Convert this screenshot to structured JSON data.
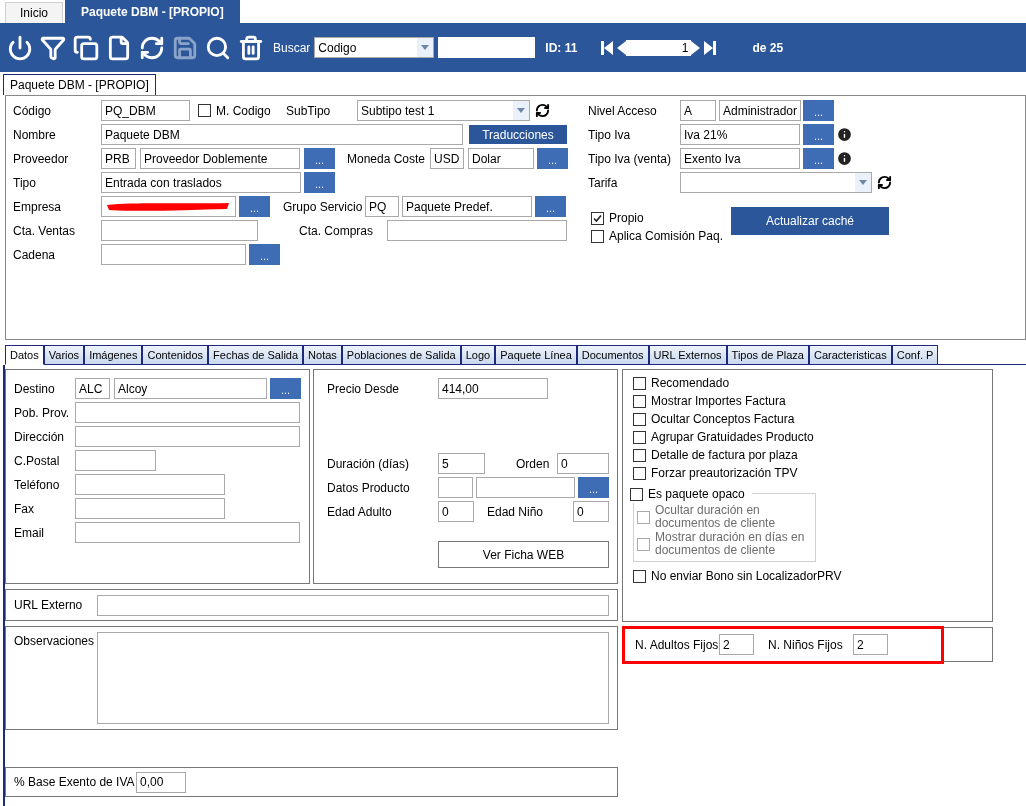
{
  "app_tabs": [
    {
      "label": "Inicio",
      "selected": false
    },
    {
      "label": "Paquete DBM - [PROPIO]",
      "selected": true
    }
  ],
  "toolbar": {
    "tools": [
      {
        "kind": "power",
        "disabled": false
      },
      {
        "kind": "filter",
        "disabled": false
      },
      {
        "kind": "copy",
        "disabled": false
      },
      {
        "kind": "new",
        "disabled": false
      },
      {
        "kind": "refresh",
        "disabled": false
      },
      {
        "kind": "save",
        "disabled": true
      },
      {
        "kind": "search",
        "disabled": false
      },
      {
        "kind": "delete",
        "disabled": false
      }
    ],
    "search_label": "Buscar",
    "search_field": "Codigo",
    "id_label": "ID: 11",
    "record": "1",
    "record_total": "de 25"
  },
  "document_tab": {
    "label": "Paquete DBM - [PROPIO]",
    "selected": true
  },
  "header": {
    "codigo": {
      "label": "Código",
      "value": "PQ_DBM"
    },
    "m_codigo": {
      "label": "M. Codigo",
      "checked": false
    },
    "subtipo": {
      "label": "SubTipo",
      "value": "Subtipo test 1"
    },
    "nombre": {
      "label": "Nombre",
      "value": "Paquete DBM"
    },
    "traducciones": "Traducciones",
    "proveedor": {
      "label": "Proveedor",
      "code": "PRB",
      "name": "Proveedor Doblemente",
      "button": "..."
    },
    "moneda": {
      "label": "Moneda Coste",
      "code": "USD",
      "name": "Dolar",
      "button": "..."
    },
    "tipo": {
      "label": "Tipo",
      "value": "Entrada con traslados",
      "button": "..."
    },
    "empresa": {
      "label": "Empresa",
      "redacted": true,
      "button": "..."
    },
    "grupo": {
      "label": "Grupo Servicio",
      "code": "PQ",
      "name": "Paquete Predef.",
      "button": "..."
    },
    "cta_ventas": {
      "label": "Cta. Ventas"
    },
    "cta_compras": {
      "label": "Cta. Compras"
    },
    "cadena": {
      "label": "Cadena",
      "button": "..."
    },
    "nivel": {
      "label": "Nivel Acceso",
      "code": "A",
      "name": "Administrador",
      "button": "..."
    },
    "tipo_iva": {
      "label": "Tipo Iva",
      "value": "Iva 21%",
      "button": "..."
    },
    "tipo_iva_venta": {
      "label": "Tipo Iva (venta)",
      "value": "Exento Iva",
      "button": "..."
    },
    "tarifa": {
      "label": "Tarifa"
    },
    "propio": {
      "label": "Propio",
      "checked": true
    },
    "aplica": {
      "label": "Aplica Comisión Paq.",
      "checked": false
    },
    "actualizar": "Actualizar caché"
  },
  "tabs": [
    {
      "label": "Datos",
      "selected": true
    },
    {
      "label": "Varios",
      "selected": false
    },
    {
      "label": "Imágenes",
      "selected": false
    },
    {
      "label": "Contenidos",
      "selected": false
    },
    {
      "label": "Fechas de Salida",
      "selected": false
    },
    {
      "label": "Notas",
      "selected": false
    },
    {
      "label": "Poblaciones de Salida",
      "selected": false
    },
    {
      "label": "Logo",
      "selected": false
    },
    {
      "label": "Paquete Línea",
      "selected": false
    },
    {
      "label": "Documentos",
      "selected": false
    },
    {
      "label": "URL Externos",
      "selected": false
    },
    {
      "label": "Tipos de Plaza",
      "selected": false
    },
    {
      "label": "Caracteristicas",
      "selected": false
    },
    {
      "label": "Conf. P",
      "selected": false
    }
  ],
  "datos": {
    "destino": {
      "label": "Destino",
      "code": "ALC",
      "name": "Alcoy",
      "button": "..."
    },
    "pob_prov": {
      "label": "Pob. Prov."
    },
    "direccion": {
      "label": "Dirección"
    },
    "cpostal": {
      "label": "C.Postal"
    },
    "telefono": {
      "label": "Teléfono"
    },
    "fax": {
      "label": "Fax"
    },
    "email": {
      "label": "Email"
    },
    "precio": {
      "label": "Precio Desde",
      "value": "414,00"
    },
    "duracion": {
      "label": "Duración (días)",
      "value": "5"
    },
    "orden": {
      "label": "Orden",
      "value": "0"
    },
    "datos_producto": {
      "label": "Datos Producto",
      "button": "..."
    },
    "edad_adulto": {
      "label": "Edad Adulto",
      "value": "0"
    },
    "edad_nino": {
      "label": "Edad Niño",
      "value": "0"
    },
    "ver_ficha": "Ver Ficha WEB",
    "options": [
      {
        "label": "Recomendado",
        "checked": false
      },
      {
        "label": "Mostrar Importes Factura",
        "checked": false
      },
      {
        "label": "Ocultar Conceptos Factura",
        "checked": false
      },
      {
        "label": "Agrupar Gratuidades Producto",
        "checked": false
      },
      {
        "label": "Detalle de factura por plaza",
        "checked": false
      },
      {
        "label": "Forzar preautorización TPV",
        "checked": false
      },
      {
        "label": "Es paquete opaco",
        "checked": false,
        "children": [
          {
            "label": "Ocultar duración en documentos de cliente",
            "checked": false,
            "disabled": true
          },
          {
            "label": "Mostrar duración en días en documentos de cliente",
            "checked": false,
            "disabled": true
          }
        ]
      },
      {
        "label": "No enviar Bono sin LocalizadorPRV",
        "checked": false
      }
    ],
    "url_externo": {
      "label": "URL Externo"
    },
    "observaciones": {
      "label": "Observaciones"
    },
    "fijos": {
      "highlighted": true,
      "adultos": {
        "label": "N. Adultos Fijos",
        "value": "2"
      },
      "ninos": {
        "label": "N. Niños Fijos",
        "value": "2"
      }
    },
    "base_exento": {
      "label": "% Base Exento de IVA",
      "value": "0,00"
    }
  }
}
